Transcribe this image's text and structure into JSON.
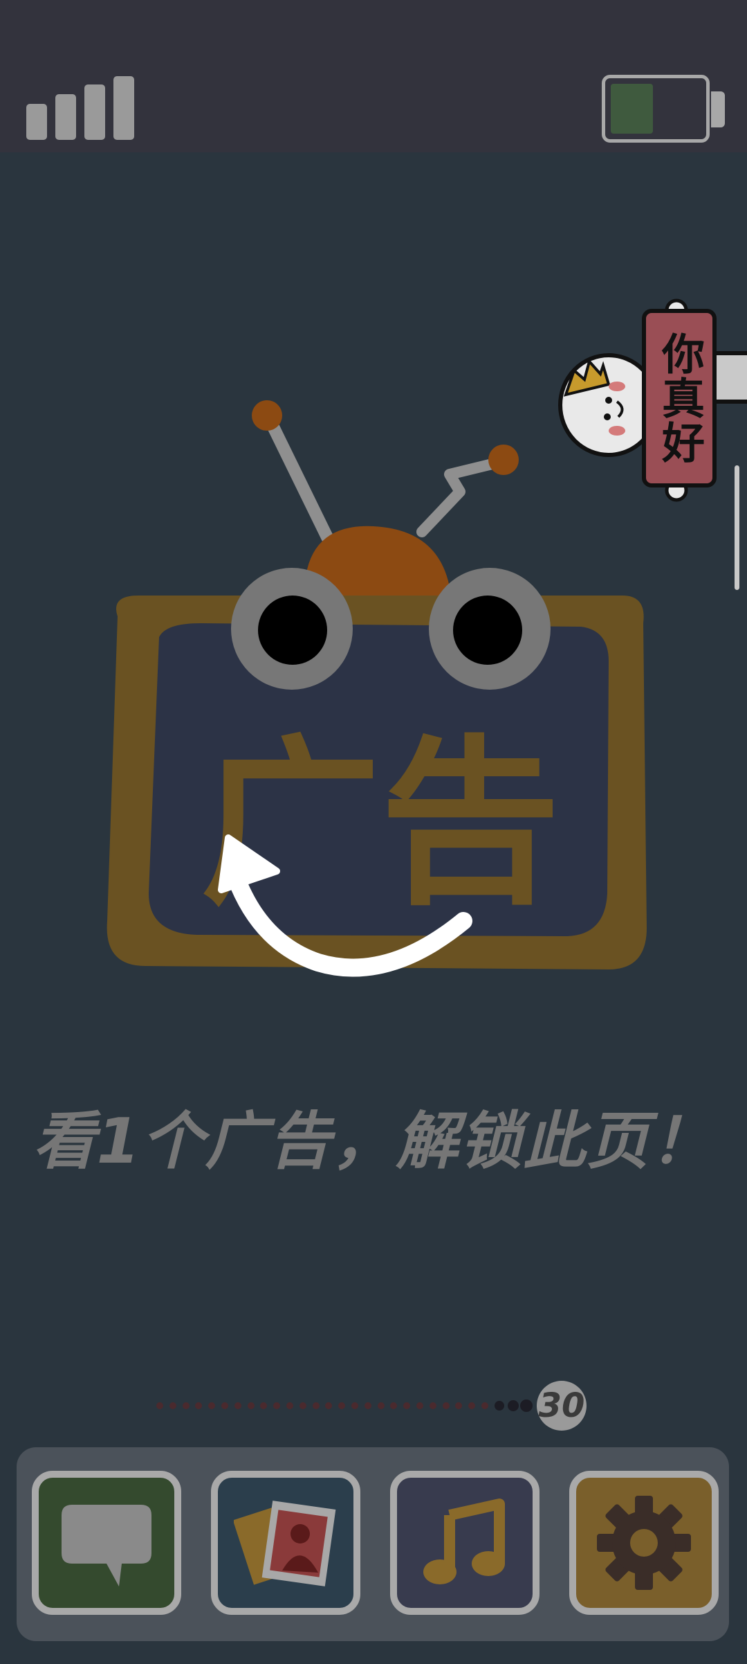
{
  "status_bar": {
    "signal_bars": 4,
    "battery_level": 0.45,
    "battery_color": "#3f5a3e"
  },
  "character": {
    "sign_text": "你真好"
  },
  "ad_panel": {
    "tv_text": "广告",
    "message": "看1个广告，解锁此页！"
  },
  "pagination": {
    "current_page": "30",
    "dot_count": 29
  },
  "dock": {
    "apps": [
      {
        "icon": "chat-bubble-icon",
        "color": "#344a2e"
      },
      {
        "icon": "photos-icon",
        "color": "#2b3e4c"
      },
      {
        "icon": "music-note-icon",
        "color": "#383b4e"
      },
      {
        "icon": "settings-gear-icon",
        "color": "#7a5f2b"
      }
    ]
  }
}
